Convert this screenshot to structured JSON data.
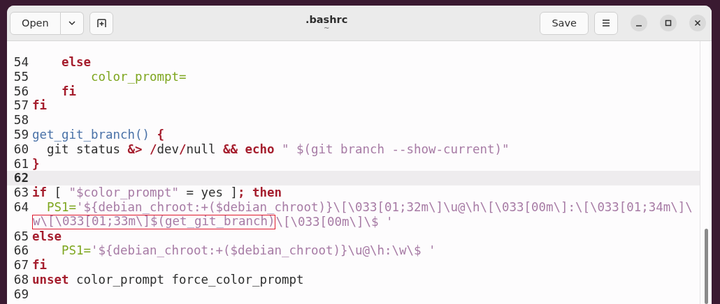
{
  "window": {
    "title": ".bashrc",
    "subtitle": "~"
  },
  "header": {
    "open_label": "Open",
    "save_label": "Save"
  },
  "lines": [
    {
      "number": "54",
      "current": false,
      "rows": [
        {
          "segments": [
            {
              "text": "    else",
              "kind": "keyword"
            }
          ]
        }
      ]
    },
    {
      "number": "55",
      "current": false,
      "rows": [
        {
          "segments": [
            {
              "text": "        color_prompt=",
              "kind": "variable"
            }
          ]
        }
      ]
    },
    {
      "number": "56",
      "current": false,
      "rows": [
        {
          "segments": [
            {
              "text": "    fi",
              "kind": "keyword"
            }
          ]
        }
      ]
    },
    {
      "number": "57",
      "current": false,
      "rows": [
        {
          "segments": [
            {
              "text": "fi",
              "kind": "keyword"
            }
          ]
        }
      ]
    },
    {
      "number": "58",
      "current": false
    },
    {
      "number": "59",
      "current": false,
      "rows": [
        {
          "segments": [
            {
              "text": "get_git_branch() ",
              "kind": "function"
            },
            {
              "text": "{",
              "kind": "keyword"
            }
          ]
        }
      ]
    },
    {
      "number": "60",
      "current": false,
      "rows": [
        {
          "segments": [
            {
              "text": "  git status ",
              "kind": "plain"
            },
            {
              "text": "&> /",
              "kind": "keyword"
            },
            {
              "text": "dev",
              "kind": "plain"
            },
            {
              "text": "/",
              "kind": "keyword"
            },
            {
              "text": "null ",
              "kind": "plain"
            },
            {
              "text": "&& echo ",
              "kind": "keyword"
            },
            {
              "text": "\" $(git branch --show-current)\"",
              "kind": "string"
            }
          ]
        }
      ]
    },
    {
      "number": "61",
      "current": false,
      "rows": [
        {
          "segments": [
            {
              "text": "}",
              "kind": "keyword"
            }
          ]
        }
      ]
    },
    {
      "number": "62",
      "current": true
    },
    {
      "number": "63",
      "current": false,
      "rows": [
        {
          "segments": [
            {
              "text": "if",
              "kind": "keyword"
            },
            {
              "text": " [ ",
              "kind": "plain"
            },
            {
              "text": "\"$color_prompt\"",
              "kind": "string"
            },
            {
              "text": " = yes ]",
              "kind": "plain"
            },
            {
              "text": "; then",
              "kind": "keyword"
            }
          ]
        }
      ]
    },
    {
      "number": "64",
      "current": false,
      "rows": [
        {
          "segments": [
            {
              "text": "  PS1=",
              "kind": "variable"
            },
            {
              "text": "'${debian_chroot:+($debian_chroot)}\\[\\033[01;32m\\]\\u@\\h\\[\\033[00m\\]:\\[\\033[01;34m\\]\\",
              "kind": "string"
            }
          ]
        },
        {
          "segments": [
            {
              "text": "w\\[\\033[01;33m\\]$(get_git_branch)",
              "kind": "boxed_string"
            },
            {
              "text": "\\[\\033[00m\\]\\$ '",
              "kind": "string"
            }
          ]
        }
      ]
    },
    {
      "number": "65",
      "current": false,
      "rows": [
        {
          "segments": [
            {
              "text": "else",
              "kind": "keyword"
            }
          ]
        }
      ]
    },
    {
      "number": "66",
      "current": false,
      "rows": [
        {
          "segments": [
            {
              "text": "    PS1=",
              "kind": "variable"
            },
            {
              "text": "'${debian_chroot:+($debian_chroot)}\\u@\\h:\\w\\$ '",
              "kind": "string"
            }
          ]
        }
      ]
    },
    {
      "number": "67",
      "current": false,
      "rows": [
        {
          "segments": [
            {
              "text": "fi",
              "kind": "keyword"
            }
          ]
        }
      ]
    },
    {
      "number": "68",
      "current": false,
      "rows": [
        {
          "segments": [
            {
              "text": "unset",
              "kind": "keyword"
            },
            {
              "text": " color_prompt force_color_prompt",
              "kind": "plain"
            }
          ]
        }
      ]
    },
    {
      "number": "69",
      "current": false
    }
  ]
}
